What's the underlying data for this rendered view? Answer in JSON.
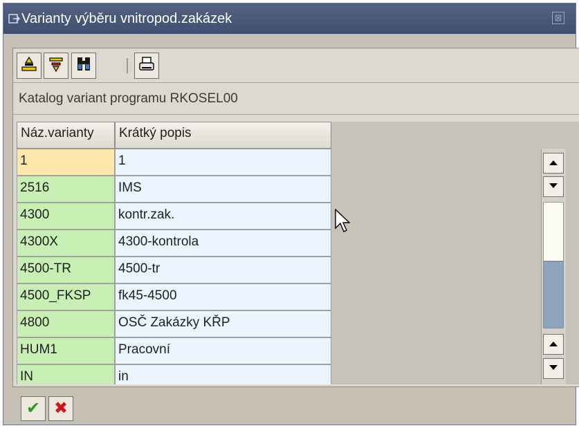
{
  "window": {
    "title": "Varianty výběru vnitropod.zakázek",
    "close_symbol": "⊠"
  },
  "toolbar": {
    "buttons": [
      {
        "icon": "sort-ascending-icon"
      },
      {
        "icon": "filter-icon"
      },
      {
        "icon": "find-binoculars-icon"
      },
      {
        "icon": "print-icon"
      }
    ]
  },
  "heading": "Katalog variant programu RKOSEL00",
  "table": {
    "columns": [
      "Náz.varianty",
      "Krátký popis"
    ],
    "rows": [
      {
        "name": "1",
        "desc": "1",
        "selected": true
      },
      {
        "name": "2516",
        "desc": "IMS"
      },
      {
        "name": "4300",
        "desc": "kontr.zak."
      },
      {
        "name": "4300X",
        "desc": "4300-kontrola"
      },
      {
        "name": "4500-TR",
        "desc": "4500-tr"
      },
      {
        "name": "4500_FKSP",
        "desc": "fk45-4500"
      },
      {
        "name": "4800",
        "desc": "OSČ Zakázky KŘP"
      },
      {
        "name": "HUM1",
        "desc": "Pracovní"
      },
      {
        "name": "IN",
        "desc": "in"
      }
    ]
  },
  "footer": {
    "buttons": [
      {
        "icon": "confirm-check-icon",
        "symbol": "✔",
        "color": "#2f9a1e"
      },
      {
        "icon": "cancel-x-icon",
        "symbol": "✖",
        "color": "#d0161d"
      }
    ]
  },
  "colors": {
    "title_bar": "#485877",
    "name_cell": "#c8f0b4",
    "desc_cell": "#ebf5ff",
    "selected_cell": "#fde7ad",
    "scroll_thumb": "#8ea4be"
  }
}
